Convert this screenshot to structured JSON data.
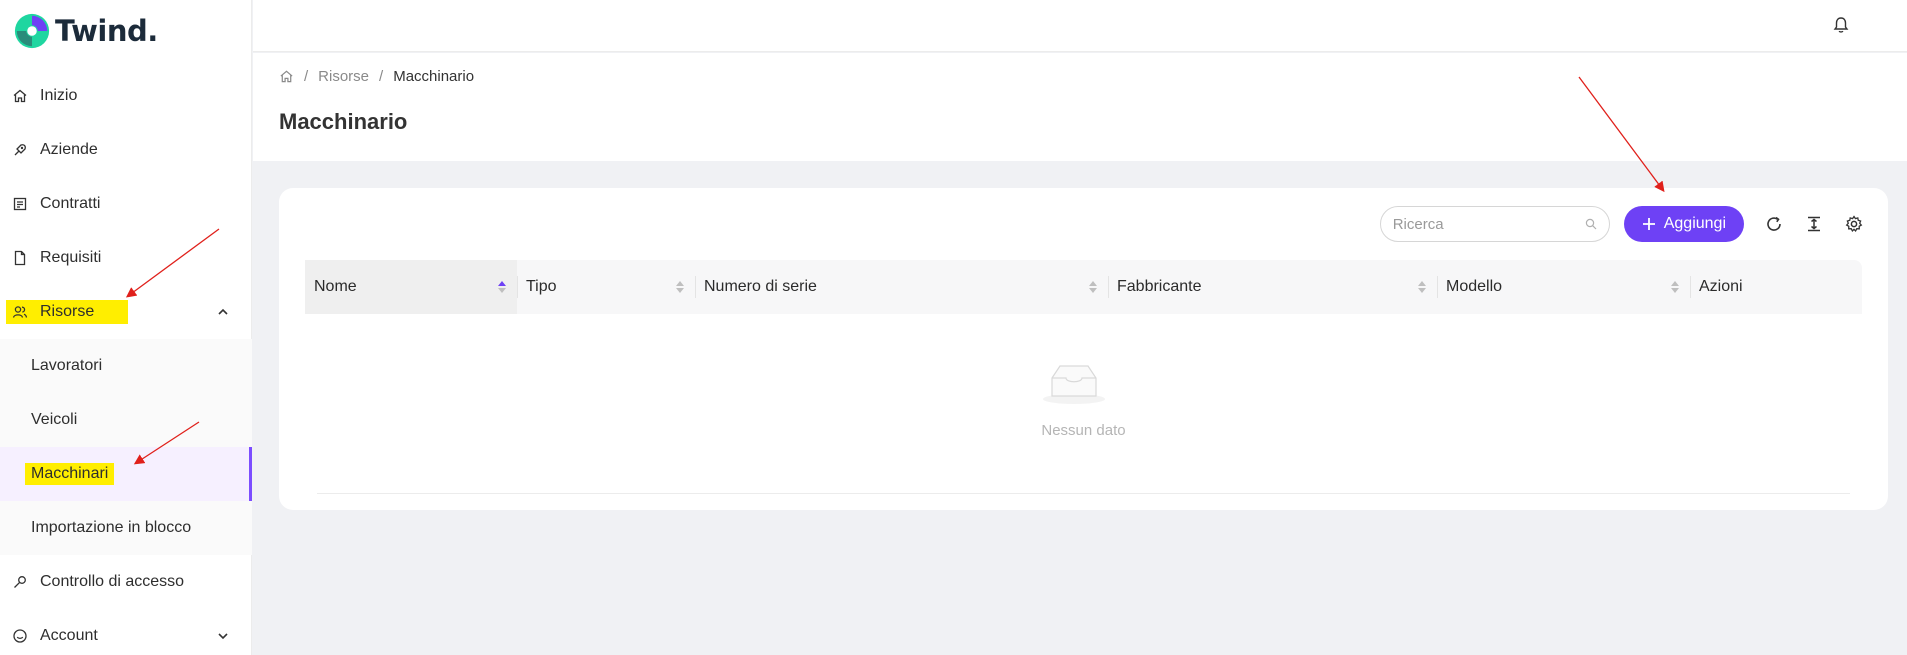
{
  "app": {
    "name": "Twind."
  },
  "sidebar": {
    "items": [
      {
        "label": "Inizio",
        "icon": "home-icon"
      },
      {
        "label": "Aziende",
        "icon": "rocket-icon"
      },
      {
        "label": "Contratti",
        "icon": "contract-icon"
      },
      {
        "label": "Requisiti",
        "icon": "file-icon"
      },
      {
        "label": "Risorse",
        "icon": "users-icon",
        "expanded": true,
        "highlighted": true
      },
      {
        "label": "Controllo di accesso",
        "icon": "key-icon"
      },
      {
        "label": "Account",
        "icon": "smile-icon",
        "expandable": true
      }
    ],
    "submenu": [
      {
        "label": "Lavoratori"
      },
      {
        "label": "Veicoli"
      },
      {
        "label": "Macchinari",
        "active": true,
        "highlighted": true
      },
      {
        "label": "Importazione in blocco"
      }
    ]
  },
  "breadcrumb": {
    "items": [
      "Risorse",
      "Macchinario"
    ]
  },
  "page": {
    "title": "Macchinario"
  },
  "toolbar": {
    "search_placeholder": "Ricerca",
    "add_label": "Aggiungi"
  },
  "table": {
    "columns": [
      "Nome",
      "Tipo",
      "Numero di serie",
      "Fabbricante",
      "Modello",
      "Azioni"
    ],
    "empty_text": "Nessun dato"
  },
  "colors": {
    "accent": "#6e41f5",
    "highlight": "#ffee00",
    "annotation": "#e0201b"
  }
}
